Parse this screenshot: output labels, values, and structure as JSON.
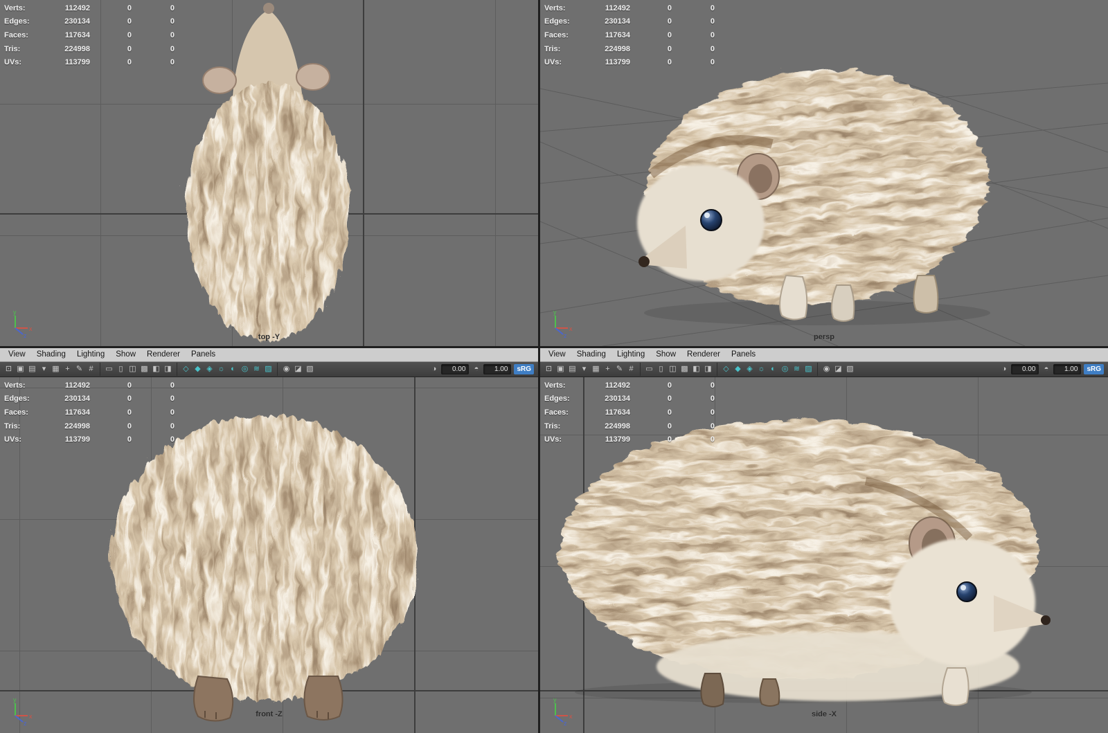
{
  "hud": {
    "rows": [
      {
        "label": "Verts:",
        "value": "112492",
        "a": "0",
        "b": "0"
      },
      {
        "label": "Edges:",
        "value": "230134",
        "a": "0",
        "b": "0"
      },
      {
        "label": "Faces:",
        "value": "117634",
        "a": "0",
        "b": "0"
      },
      {
        "label": "Tris:",
        "value": "224998",
        "a": "0",
        "b": "0"
      },
      {
        "label": "UVs:",
        "value": "113799",
        "a": "0",
        "b": "0"
      }
    ]
  },
  "viewports": {
    "top_label": "top -Y",
    "persp_label": "persp",
    "front_label": "front -Z",
    "side_label": "side -X"
  },
  "panel_menu": {
    "items": [
      "View",
      "Shading",
      "Lighting",
      "Show",
      "Renderer",
      "Panels"
    ]
  },
  "toolbar": {
    "icons": [
      {
        "name": "camera-select-icon",
        "glyph": "⊡",
        "tint": "gray"
      },
      {
        "name": "lock-camera-icon",
        "glyph": "▣",
        "tint": "gray"
      },
      {
        "name": "camera-attributes-icon",
        "glyph": "▤",
        "tint": "gray"
      },
      {
        "name": "bookmarks-icon",
        "glyph": "▾",
        "tint": "gray"
      },
      {
        "name": "image-plane-icon",
        "glyph": "▦",
        "tint": "gray"
      },
      {
        "name": "two-d-pan-zoom-icon",
        "glyph": "+",
        "tint": "gray"
      },
      {
        "name": "grease-pencil-icon",
        "glyph": "✎",
        "tint": "gray"
      },
      {
        "name": "grid-icon",
        "glyph": "#",
        "tint": "gray"
      },
      {
        "name": "film-gate-icon",
        "glyph": "▭",
        "tint": "gray"
      },
      {
        "name": "resolution-gate-icon",
        "glyph": "▯",
        "tint": "gray"
      },
      {
        "name": "gate-mask-icon",
        "glyph": "◫",
        "tint": "gray"
      },
      {
        "name": "field-chart-icon",
        "glyph": "▩",
        "tint": "gray"
      },
      {
        "name": "safe-action-icon",
        "glyph": "◧",
        "tint": "gray"
      },
      {
        "name": "safe-title-icon",
        "glyph": "◨",
        "tint": "gray"
      },
      {
        "name": "wireframe-icon",
        "glyph": "◇",
        "tint": "teal"
      },
      {
        "name": "shaded-icon",
        "glyph": "◆",
        "tint": "teal"
      },
      {
        "name": "textured-icon",
        "glyph": "◈",
        "tint": "teal"
      },
      {
        "name": "use-all-lights-icon",
        "glyph": "☼",
        "tint": "teal"
      },
      {
        "name": "shadows-icon",
        "glyph": "◐",
        "tint": "teal"
      },
      {
        "name": "ambient-occlusion-icon",
        "glyph": "◎",
        "tint": "teal"
      },
      {
        "name": "motion-blur-icon",
        "glyph": "≋",
        "tint": "teal"
      },
      {
        "name": "multisample-icon",
        "glyph": "▨",
        "tint": "teal"
      },
      {
        "name": "depth-of-field-icon",
        "glyph": "◉",
        "tint": "gray"
      },
      {
        "name": "isolate-select-icon",
        "glyph": "◪",
        "tint": "gray"
      },
      {
        "name": "x-ray-icon",
        "glyph": "▧",
        "tint": "gray"
      }
    ],
    "exposure_icon_glyph": "◑",
    "exposure_value": "0.00",
    "gamma_icon_glyph": "◓",
    "gamma_value": "1.00",
    "srgb_label": "sRG"
  },
  "colors": {
    "viewport_bg": "#6f6f6f",
    "grid_minor": "#5d5d5d",
    "grid_major": "#3d3d3d",
    "menu_bg": "#cdcdcd",
    "toolbar_bg": "#454545",
    "accent_teal": "#4ac3ca",
    "srgb_blue": "#3f7ec4",
    "hud_text": "#efefef"
  }
}
